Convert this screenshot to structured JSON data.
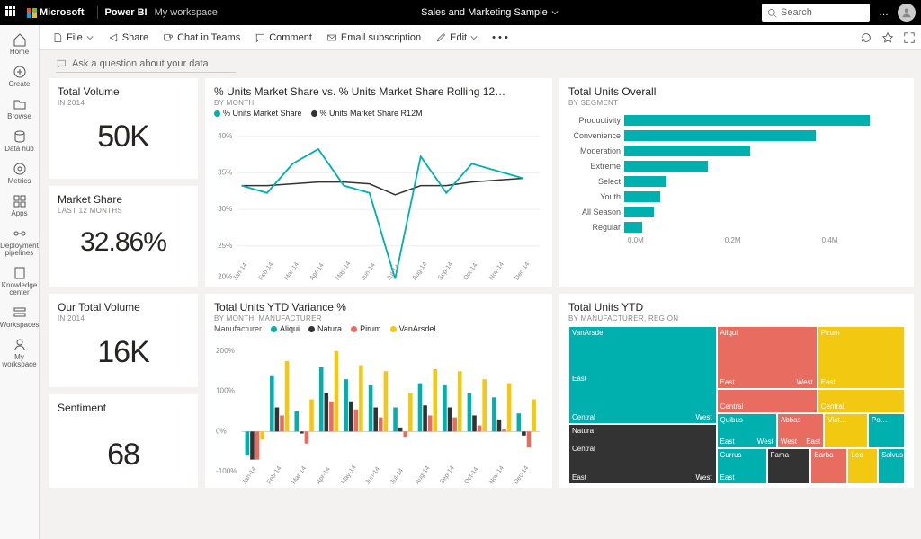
{
  "topbar": {
    "brand": "Microsoft",
    "product": "Power BI",
    "workspace": "My workspace",
    "title": "Sales and Marketing Sample",
    "search_placeholder": "Search",
    "more": "…"
  },
  "nav": [
    {
      "id": "home",
      "label": "Home"
    },
    {
      "id": "create",
      "label": "Create"
    },
    {
      "id": "browse",
      "label": "Browse"
    },
    {
      "id": "datahub",
      "label": "Data hub"
    },
    {
      "id": "metrics",
      "label": "Metrics"
    },
    {
      "id": "apps",
      "label": "Apps"
    },
    {
      "id": "pipelines",
      "label": "Deployment pipelines"
    },
    {
      "id": "knowledge",
      "label": "Knowledge center"
    },
    {
      "id": "workspaces",
      "label": "Workspaces"
    },
    {
      "id": "myws",
      "label": "My workspace"
    }
  ],
  "toolbar": {
    "file": "File",
    "share": "Share",
    "teams": "Chat in Teams",
    "comment": "Comment",
    "email": "Email subscription",
    "edit": "Edit"
  },
  "qna": "Ask a question about your data",
  "kpis": {
    "volume": {
      "title": "Total Volume",
      "sub": "IN 2014",
      "value": "50K"
    },
    "share": {
      "title": "Market Share",
      "sub": "LAST 12 MONTHS",
      "value": "32.86%"
    },
    "our_volume": {
      "title": "Our Total Volume",
      "sub": "IN 2014",
      "value": "16K"
    },
    "sentiment": {
      "title": "Sentiment",
      "sub": "",
      "value": "68"
    }
  },
  "line": {
    "title": "% Units Market Share vs. % Units Market Share Rolling 12…",
    "sub": "BY MONTH",
    "legend": [
      "% Units Market Share",
      "% Units Market Share R12M"
    ]
  },
  "hbar": {
    "title": "Total Units Overall",
    "sub": "BY SEGMENT",
    "axis": [
      "0.0M",
      "0.2M",
      "0.4M"
    ]
  },
  "variance": {
    "title": "Total Units YTD Variance %",
    "sub": "BY MONTH, MANUFACTURER",
    "legend_label": "Manufacturer",
    "legend": [
      "Aliqui",
      "Natura",
      "Pirum",
      "VanArsdel"
    ]
  },
  "tree": {
    "title": "Total Units YTD",
    "sub": "BY MANUFACTURER, REGION",
    "labels": {
      "van": "VanArsdel",
      "nat": "Natura",
      "aliqui": "Aliqui",
      "pirum": "Pirum",
      "quibus": "Quibus",
      "abbas": "Abbas",
      "vict": "Vict…",
      "po": "Po…",
      "currus": "Currus",
      "fama": "Fama",
      "barba": "Barba",
      "leo": "Leo",
      "salvus": "Salvus",
      "east": "East",
      "west": "West",
      "central": "Central"
    }
  },
  "chart_data": [
    {
      "type": "line",
      "title": "% Units Market Share vs. % Units Market Share Rolling 12…",
      "xlabel": "",
      "ylabel": "",
      "ylim": [
        20,
        40
      ],
      "categories": [
        "Jan-14",
        "Feb-14",
        "Mar-14",
        "Apr-14",
        "May-14",
        "Jun-14",
        "Jul-14",
        "Aug-14",
        "Sep-14",
        "Oct-14",
        "Nov-14",
        "Dec-14"
      ],
      "series": [
        {
          "name": "% Units Market Share",
          "color": "#00b0ae",
          "values": [
            33,
            32,
            36,
            38,
            33,
            32,
            20,
            37,
            32,
            36,
            35,
            34
          ]
        },
        {
          "name": "% Units Market Share R12M",
          "color": "#333333",
          "values": [
            33,
            33,
            33.2,
            33.4,
            33.4,
            33.2,
            32,
            33,
            33,
            33.5,
            33.8,
            34
          ]
        }
      ]
    },
    {
      "type": "bar",
      "orientation": "horizontal",
      "title": "Total Units Overall",
      "xlabel": "",
      "ylabel": "",
      "xlim": [
        0,
        0.45
      ],
      "categories": [
        "Productivity",
        "Convenience",
        "Moderation",
        "Extreme",
        "Select",
        "Youth",
        "All Season",
        "Regular"
      ],
      "values": [
        0.41,
        0.32,
        0.21,
        0.14,
        0.07,
        0.06,
        0.05,
        0.03
      ]
    },
    {
      "type": "bar",
      "title": "Total Units YTD Variance %",
      "xlabel": "",
      "ylabel": "",
      "ylim": [
        -100,
        200
      ],
      "categories": [
        "Jan-14",
        "Feb-14",
        "Mar-14",
        "Apr-14",
        "May-14",
        "Jun-14",
        "Jul-14",
        "Aug-14",
        "Sep-14",
        "Oct-14",
        "Nov-14",
        "Dec-14"
      ],
      "series": [
        {
          "name": "Aliqui",
          "color": "#00b0ae",
          "values": [
            -60,
            140,
            50,
            160,
            130,
            115,
            60,
            120,
            115,
            95,
            85,
            45
          ]
        },
        {
          "name": "Natura",
          "color": "#333333",
          "values": [
            -70,
            60,
            -5,
            95,
            75,
            60,
            10,
            65,
            60,
            40,
            30,
            -10
          ]
        },
        {
          "name": "Pirum",
          "color": "#e86c60",
          "values": [
            -70,
            40,
            -30,
            75,
            55,
            35,
            -15,
            40,
            35,
            15,
            5,
            -40
          ]
        },
        {
          "name": "VanArsdel",
          "color": "#f2c811",
          "values": [
            -20,
            175,
            80,
            200,
            165,
            150,
            95,
            155,
            150,
            130,
            120,
            80
          ]
        }
      ]
    },
    {
      "type": "treemap",
      "title": "Total Units YTD",
      "nodes": [
        {
          "name": "VanArsdel",
          "color": "#00b0ae",
          "value": 44,
          "children": [
            {
              "name": "East",
              "value": 20
            },
            {
              "name": "Central",
              "value": 14
            },
            {
              "name": "West",
              "value": 10
            }
          ]
        },
        {
          "name": "Natura",
          "color": "#333333",
          "value": 18,
          "children": [
            {
              "name": "East",
              "value": 8
            },
            {
              "name": "Central",
              "value": 5
            },
            {
              "name": "West",
              "value": 5
            }
          ]
        },
        {
          "name": "Aliqui",
          "color": "#e86c60",
          "value": 12,
          "children": [
            {
              "name": "East",
              "value": 5
            },
            {
              "name": "West",
              "value": 4
            },
            {
              "name": "Central",
              "value": 3
            }
          ]
        },
        {
          "name": "Pirum",
          "color": "#f2c811",
          "value": 7,
          "children": [
            {
              "name": "East",
              "value": 4
            },
            {
              "name": "Central",
              "value": 3
            }
          ]
        },
        {
          "name": "Quibus",
          "color": "#00b0ae",
          "value": 5,
          "children": [
            {
              "name": "East",
              "value": 3
            },
            {
              "name": "West",
              "value": 2
            }
          ]
        },
        {
          "name": "Abbas",
          "color": "#e86c60",
          "value": 4
        },
        {
          "name": "Victoria",
          "color": "#f2c811",
          "value": 3
        },
        {
          "name": "Pomum",
          "color": "#00b0ae",
          "value": 2
        },
        {
          "name": "Currus",
          "color": "#00b0ae",
          "value": 3
        },
        {
          "name": "Fama",
          "color": "#333333",
          "value": 2
        },
        {
          "name": "Barba",
          "color": "#e86c60",
          "value": 2
        },
        {
          "name": "Leo",
          "color": "#f2c811",
          "value": 2
        },
        {
          "name": "Salvus",
          "color": "#00b0ae",
          "value": 2
        }
      ]
    }
  ]
}
